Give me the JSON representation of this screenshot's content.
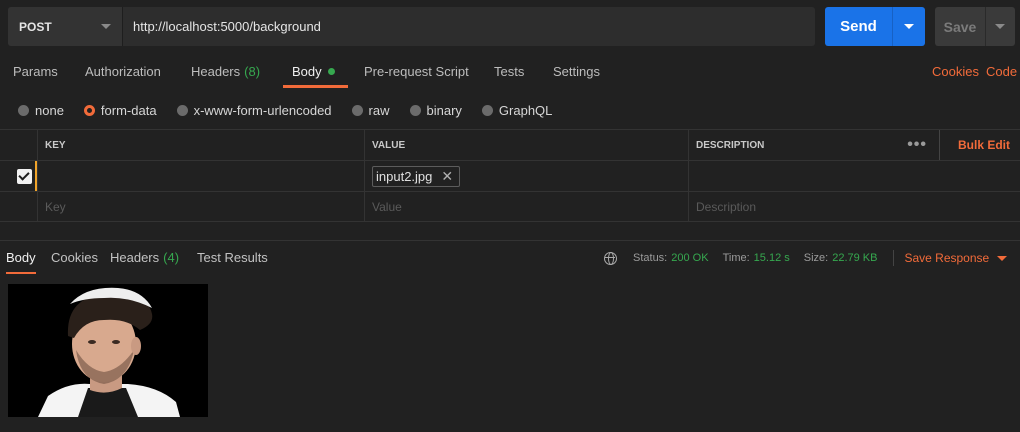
{
  "request": {
    "method": "POST",
    "url": "http://localhost:5000/background",
    "send_label": "Send",
    "save_label": "Save"
  },
  "tabs": [
    {
      "label": "Params"
    },
    {
      "label": "Authorization"
    },
    {
      "label": "Headers",
      "count": "(8)"
    },
    {
      "label": "Body"
    },
    {
      "label": "Pre-request Script"
    },
    {
      "label": "Tests"
    },
    {
      "label": "Settings"
    }
  ],
  "links": {
    "cookies": "Cookies",
    "code": "Code"
  },
  "body_types": [
    "none",
    "form-data",
    "x-www-form-urlencoded",
    "raw",
    "binary",
    "GraphQL"
  ],
  "body_type_selected": "form-data",
  "table": {
    "headers": {
      "key": "KEY",
      "value": "VALUE",
      "description": "DESCRIPTION"
    },
    "bulk_edit": "Bulk Edit",
    "more": "•••",
    "rows": [
      {
        "checked": true,
        "key": "",
        "value_file": "input2.jpg",
        "description": ""
      }
    ],
    "placeholders": {
      "key": "Key",
      "value": "Value",
      "description": "Description"
    }
  },
  "response": {
    "tabs": [
      {
        "label": "Body"
      },
      {
        "label": "Cookies"
      },
      {
        "label": "Headers",
        "count": "(4)"
      },
      {
        "label": "Test Results"
      }
    ],
    "status_label": "Status:",
    "status": "200 OK",
    "time_label": "Time:",
    "time": "15.12 s",
    "size_label": "Size:",
    "size": "22.79 KB",
    "save_response": "Save Response"
  },
  "colors": {
    "accent": "#f26b3a",
    "send": "#1a73e8",
    "ok": "#36a84f"
  }
}
